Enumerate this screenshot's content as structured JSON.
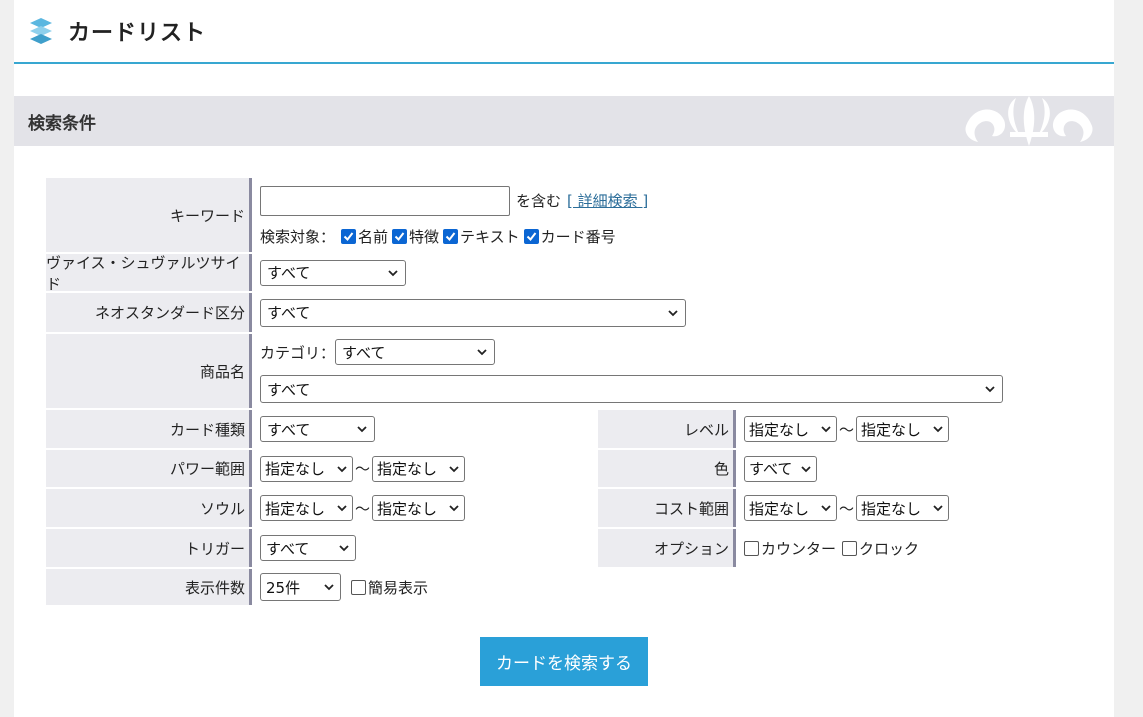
{
  "header": {
    "title": "カードリスト"
  },
  "section": {
    "title": "検索条件"
  },
  "keyword": {
    "label": "キーワード",
    "value": "",
    "contains_text": "を含む",
    "detail_link": "[ 詳細検索 ]",
    "target_label": "検索対象：",
    "targets": [
      {
        "label": "名前",
        "checked": true
      },
      {
        "label": "特徴",
        "checked": true
      },
      {
        "label": "テキスト",
        "checked": true
      },
      {
        "label": "カード番号",
        "checked": true
      }
    ]
  },
  "side": {
    "label": "ヴァイス・シュヴァルツサイド",
    "value": "すべて"
  },
  "neo": {
    "label": "ネオスタンダード区分",
    "value": "すべて"
  },
  "product": {
    "label": "商品名",
    "category_label": "カテゴリ：",
    "category_value": "すべて",
    "value": "すべて"
  },
  "card_type": {
    "label": "カード種類",
    "value": "すべて"
  },
  "level": {
    "label": "レベル",
    "from": "指定なし",
    "tilde": "～",
    "to": "指定なし"
  },
  "power": {
    "label": "パワー範囲",
    "from": "指定なし",
    "tilde": "～",
    "to": "指定なし"
  },
  "color": {
    "label": "色",
    "value": "すべて"
  },
  "soul": {
    "label": "ソウル",
    "from": "指定なし",
    "tilde": "～",
    "to": "指定なし"
  },
  "cost": {
    "label": "コスト範囲",
    "from": "指定なし",
    "tilde": "～",
    "to": "指定なし"
  },
  "trigger": {
    "label": "トリガー",
    "value": "すべて"
  },
  "option": {
    "label": "オプション",
    "counter": "カウンター",
    "clock": "クロック"
  },
  "count": {
    "label": "表示件数",
    "value": "25件",
    "simple": "簡易表示"
  },
  "search_button": "カードを検索する",
  "colors": {
    "accent": "#2aa0d8",
    "label_bg": "#ececf0",
    "header_line": "#38a7d1"
  }
}
